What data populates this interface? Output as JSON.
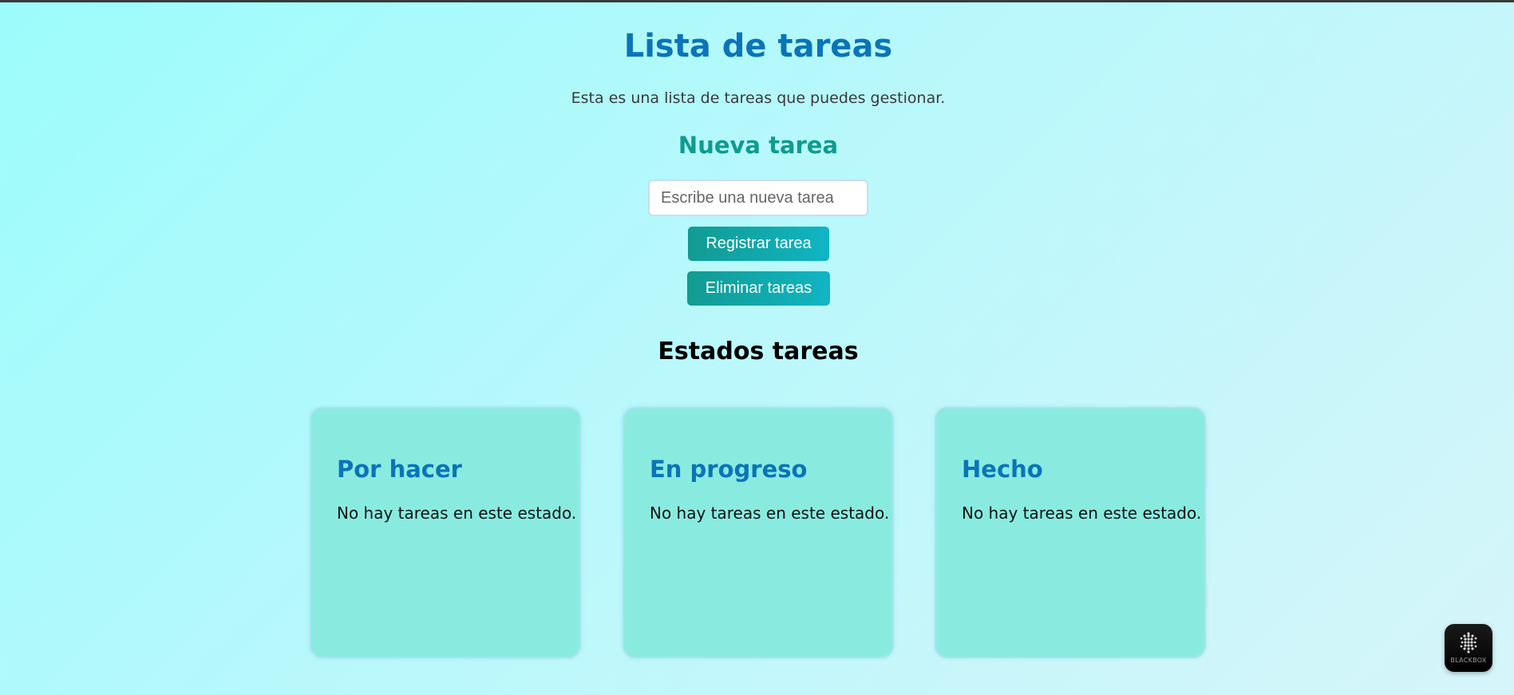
{
  "header": {
    "title": "Lista de tareas",
    "subtitle": "Esta es una lista de tareas que puedes gestionar."
  },
  "new_task": {
    "heading": "Nueva tarea",
    "input_placeholder": "Escribe una nueva tarea",
    "input_value": "",
    "register_label": "Registrar tarea",
    "delete_label": "Eliminar tareas"
  },
  "states": {
    "heading": "Estados tareas",
    "columns": [
      {
        "title": "Por hacer",
        "empty_text": "No hay tareas en este estado."
      },
      {
        "title": "En progreso",
        "empty_text": "No hay tareas en este estado."
      },
      {
        "title": "Hecho",
        "empty_text": "No hay tareas en este estado."
      }
    ]
  },
  "widget": {
    "label": "BLACKBOX",
    "icon": "blackbox-logo-icon"
  },
  "colors": {
    "title": "#0b74b8",
    "section_heading": "#0f9b8e",
    "card_bg": "#89ebe0",
    "button_start": "#129b92",
    "button_end": "#10b5c4"
  }
}
